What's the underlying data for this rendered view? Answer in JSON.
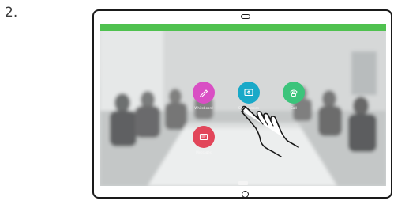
{
  "step_number": "2.",
  "device": {
    "name": "touch-controller-tablet"
  },
  "screen": {
    "title_bar": {
      "text": "",
      "color": "#4fc14f"
    },
    "apps": [
      {
        "id": "whiteboard",
        "label": "Whiteboard",
        "color": "#d94fc4",
        "icon": "pen-icon"
      },
      {
        "id": "share",
        "label": "Share screen",
        "color": "#19a9c8",
        "icon": "screen-share-icon"
      },
      {
        "id": "call",
        "label": "Call",
        "color": "#3cc47b",
        "icon": "phone-icon"
      },
      {
        "id": "messages",
        "label": "Messages",
        "color": "#e2465a",
        "icon": "message-icon"
      }
    ],
    "bottom_tab_label": ""
  },
  "gesture": {
    "icon": "tap-hand-icon"
  }
}
